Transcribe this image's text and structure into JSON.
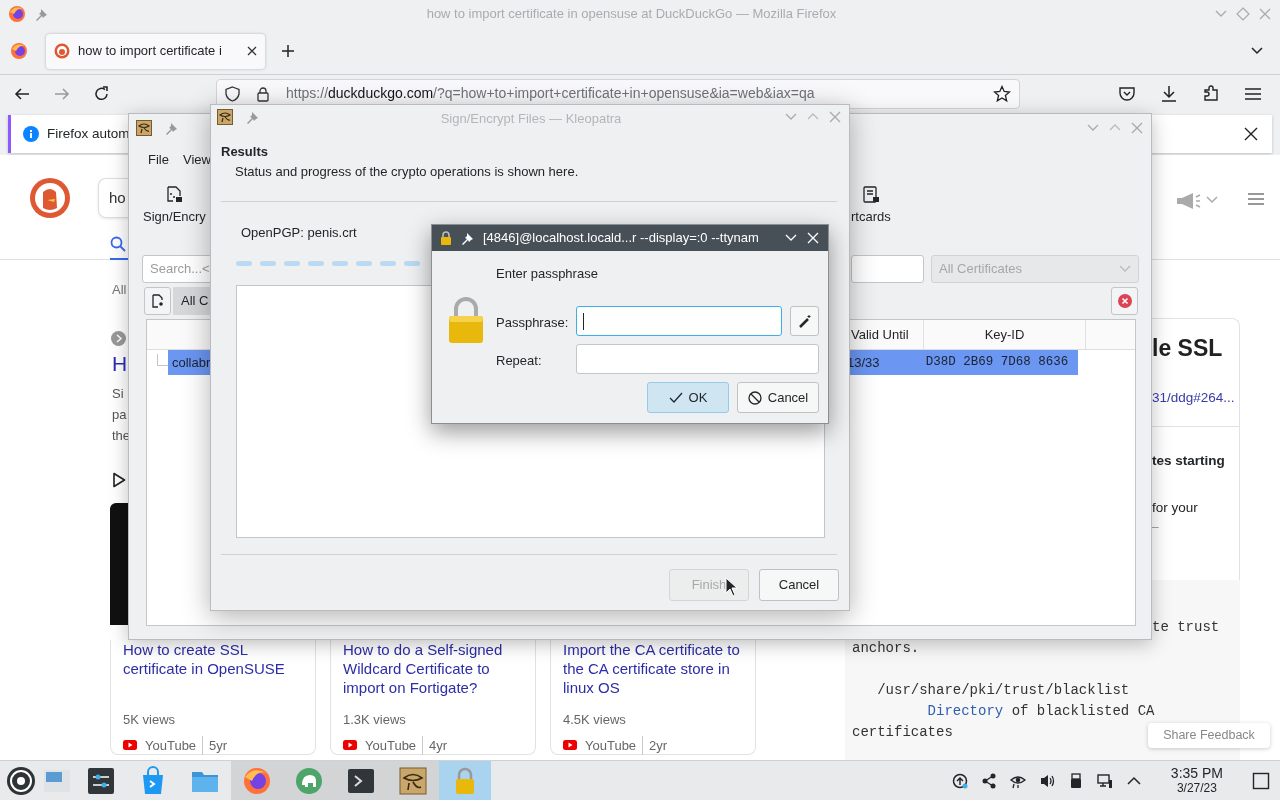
{
  "firefox": {
    "window_title": "how to import certificate in opensuse at DuckDuckGo — Mozilla Firefox",
    "tabs": [
      {
        "label": "how to import certificate i",
        "selected": true
      }
    ],
    "url": {
      "scheme": "https://",
      "domain": "duckduckgo.com",
      "path": "/?q=how+to+import+certificate+in+opensuse&ia=web&iax=qa"
    },
    "notification": "Firefox autom"
  },
  "page": {
    "search_query": "ho",
    "search_tab_selected": true,
    "filter_label": "All",
    "result_title": "H",
    "snippet_lines": [
      "Si",
      "pa",
      "the"
    ],
    "videos": [
      {
        "title": "How to create SSL certificate in OpenSUSE",
        "views": "5K views",
        "source": "YouTube",
        "age": "5yr"
      },
      {
        "title": "How to do a Self-signed Wildcard Certificate to import on Fortigate?",
        "views": "1.3K views",
        "source": "YouTube",
        "age": "4yr"
      },
      {
        "title": "Import the CA certificate to the CA certificate store in linux OS",
        "views": "4.5K views",
        "source": "YouTube",
        "age": "2yr"
      }
    ],
    "answer": {
      "title": "le SSL",
      "link": "31/ddg#264...",
      "bold_text": "tes starting",
      "text": "for your",
      "mark": "–"
    },
    "code_paragraphs": [
      [
        [
          {
            "text": "te trust",
            "kind": "plain"
          }
        ],
        [
          {
            "text": "anchors.",
            "kind": "plain"
          }
        ]
      ],
      [
        [
          {
            "text": "   /usr/share/pki/trust/blacklist",
            "kind": "plain"
          }
        ],
        [
          {
            "text": "         Directory",
            "kind": "keyword"
          },
          {
            "text": " of blacklisted CA",
            "kind": "plain"
          }
        ],
        [
          {
            "text": "certificates",
            "kind": "plain"
          }
        ]
      ]
    ],
    "share_feedback": "Share Feedback"
  },
  "kleopatra": {
    "menu": [
      "File",
      "View"
    ],
    "toolbar": [
      {
        "label": "Sign/Encry"
      },
      {
        "label": "rtcards"
      }
    ],
    "search_placeholder": "Search...<",
    "filter": {
      "value": "All Certificates",
      "disabled": true
    },
    "view_tab": {
      "label": "All C",
      "selected": true
    },
    "table": {
      "columns": [
        "Valid Until",
        "Key-ID"
      ],
      "rows": [
        {
          "name": "collabr",
          "valid_until": "13/33",
          "key_id": "D38D 2B69 7D68 8636",
          "selected": true
        }
      ]
    }
  },
  "sign_dialog": {
    "title": "Sign/Encrypt Files — Kleopatra",
    "heading": "Results",
    "subtitle": "Status and progress of the crypto operations is shown here.",
    "operation": "OpenPGP: penis.crt",
    "buttons": [
      {
        "label": "Finish",
        "disabled": true
      },
      {
        "label": "Cancel",
        "disabled": false
      }
    ]
  },
  "pinentry": {
    "title": "[4846]@localhost.locald...r --display=:0 --ttynam",
    "prompt": "Enter passphrase",
    "fields": [
      {
        "label": "Passphrase:",
        "focused": true
      },
      {
        "label": "Repeat:",
        "focused": false
      }
    ],
    "buttons": [
      {
        "label": "OK",
        "kind": "ok",
        "default": true
      },
      {
        "label": "Cancel",
        "kind": "cancel",
        "default": false
      }
    ]
  },
  "taskbar": {
    "apps": [
      {
        "running": false,
        "active": false
      },
      {
        "running": false,
        "active": false
      },
      {
        "running": false,
        "active": false
      },
      {
        "running": false,
        "active": false
      },
      {
        "running": false,
        "active": false
      },
      {
        "running": true,
        "active": false
      },
      {
        "running": true,
        "active": false
      },
      {
        "running": true,
        "active": false
      },
      {
        "running": true,
        "active": false
      },
      {
        "running": true,
        "active": true
      }
    ],
    "time": "3:35 PM",
    "date": "3/27/23"
  }
}
